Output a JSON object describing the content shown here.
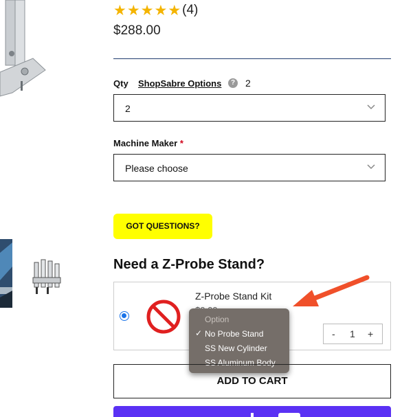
{
  "product": {
    "rating_count": "(4)",
    "stars": 5,
    "price": "$288.00"
  },
  "options": {
    "qty_label": "Qty",
    "shopsabre_link": "ShopSabre Options",
    "help_glyph": "?",
    "qty_count": "2",
    "qty_select_value": "2",
    "machine_maker_label": "Machine Maker",
    "required_mark": "*",
    "machine_maker_value": "Please choose"
  },
  "questions_button": "GOT QUESTIONS?",
  "zprobe": {
    "heading": "Need a Z-Probe Stand?",
    "kit_name": "Z-Probe Stand Kit",
    "kit_price_partial": "$0.00",
    "stepper_minus": "-",
    "stepper_value": "1",
    "stepper_plus": "+",
    "dropdown": {
      "header": "Option",
      "check_mark": "✓",
      "options": [
        "No Probe Stand",
        "SS New Cylinder",
        "SS Aluminum Body"
      ],
      "selected": "No Probe Stand"
    }
  },
  "add_to_cart": "ADD TO CART",
  "colors": {
    "star": "#f4b400",
    "highlight_button": "#ffff00",
    "divider": "#1f3b6e",
    "annotation_arrow": "#f0502a",
    "no_sign": "#e02020",
    "pay_button": "#5a31f4"
  }
}
